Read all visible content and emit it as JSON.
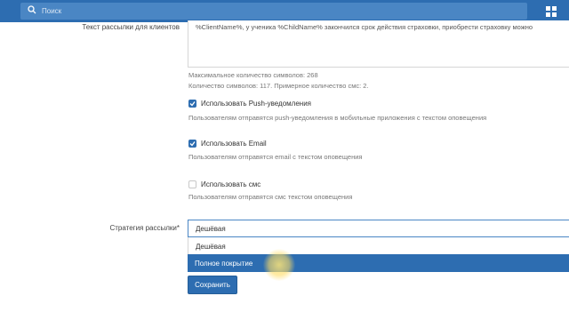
{
  "topbar": {
    "search_placeholder": "Поиск",
    "search_icon": "search-icon",
    "apps_icon": "apps-grid-icon",
    "color": "#2d6db1"
  },
  "form": {
    "client_text_label": "Текст рассылки для клиентов",
    "client_text_value": "%ClientName%, у ученика %ChildName% закончился срок действия страховки, приобрести страховку можно",
    "max_chars": "Максимальное количество символов: 268",
    "char_count": "Количество символов: 117. Примерное количество смс: 2.",
    "options": [
      {
        "label": "Использовать Push-уведомления",
        "checked": true,
        "hint": "Пользователям отправятся push-уведомления в мобильные приложения с текстом оповещения"
      },
      {
        "label": "Использовать Email",
        "checked": true,
        "hint": "Пользователям отправятся email с текстом оповещения"
      },
      {
        "label": "Использовать смс",
        "checked": false,
        "hint": "Пользователям отправятся смс текстом оповещения"
      }
    ],
    "strategy_label": "Стратегия рассылки*",
    "strategy_selected": "Дешёвая",
    "strategy_options": [
      "Дешёвая",
      "Полное покрытие"
    ],
    "strategy_highlighted": "Полное покрытие",
    "save_label": "Сохранить"
  }
}
